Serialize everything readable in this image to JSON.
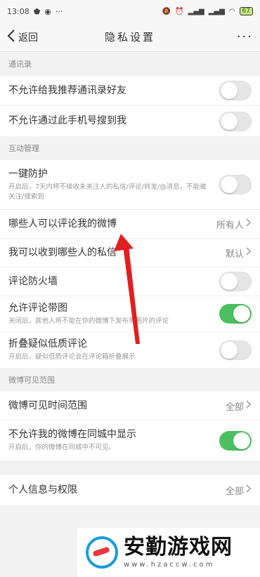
{
  "status_bar": {
    "time": "13:08",
    "dots": "···",
    "battery": "67"
  },
  "nav": {
    "back_label": "返回",
    "title": "隐私设置",
    "more": "···"
  },
  "sections": {
    "contacts": {
      "header": "通讯录",
      "items": [
        {
          "label": "不允许给我推荐通讯录好友",
          "toggle": false
        },
        {
          "label": "不允许通过此手机号搜到我",
          "toggle": false
        }
      ]
    },
    "interaction": {
      "header": "互动管理",
      "items": [
        {
          "label": "一键防护",
          "desc": "开启后，7天内将不接收未关注人的私信/评论/转发/@消息，不能被关注/搜索到",
          "toggle": false
        },
        {
          "label": "哪些人可以评论我的微博",
          "value": "所有人"
        },
        {
          "label": "我可以收到哪些人的私信",
          "value": "默认"
        },
        {
          "label": "评论防火墙",
          "toggle": false
        },
        {
          "label": "允许评论带图",
          "desc": "关闭后，其他人将不能在你的微博下发布带图片的评论",
          "toggle": true
        },
        {
          "label": "折叠疑似低质评论",
          "desc": "开启后，疑似低质评论会在评论箱折叠展示",
          "toggle": false
        }
      ]
    },
    "visibility": {
      "header": "微博可见范围",
      "items": [
        {
          "label": "微博可见时间范围",
          "value": "全部"
        },
        {
          "label": "不允许我的微博在同城中显示",
          "desc": "开启后，你的微博在同城中不可见。",
          "toggle": true
        }
      ]
    },
    "personal": {
      "items": [
        {
          "label": "个人信息与权限",
          "value": "全部"
        }
      ]
    }
  },
  "colors": {
    "toggle_on": "#4cc060",
    "toggle_off": "#e6e6e6",
    "arrow": "#e02020"
  },
  "watermark": {
    "title": "安勤游戏网",
    "url": "www.hzaccw.com"
  }
}
